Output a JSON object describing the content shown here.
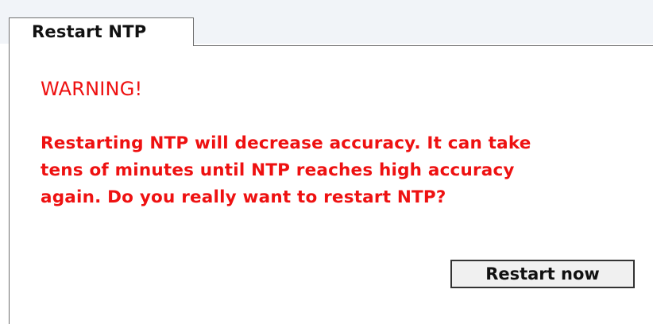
{
  "tab": {
    "label": "Restart NTP"
  },
  "warning": {
    "title": "WARNING!",
    "lines": [
      "Restarting NTP will decrease accuracy. It can take",
      "tens of minutes until NTP reaches high accuracy",
      "again. Do you really want to restart NTP?"
    ]
  },
  "actions": {
    "restart_label": "Restart now"
  },
  "colors": {
    "warning": "#ee1111",
    "border": "#6f6f6f",
    "button_background": "#f0f0f0"
  }
}
